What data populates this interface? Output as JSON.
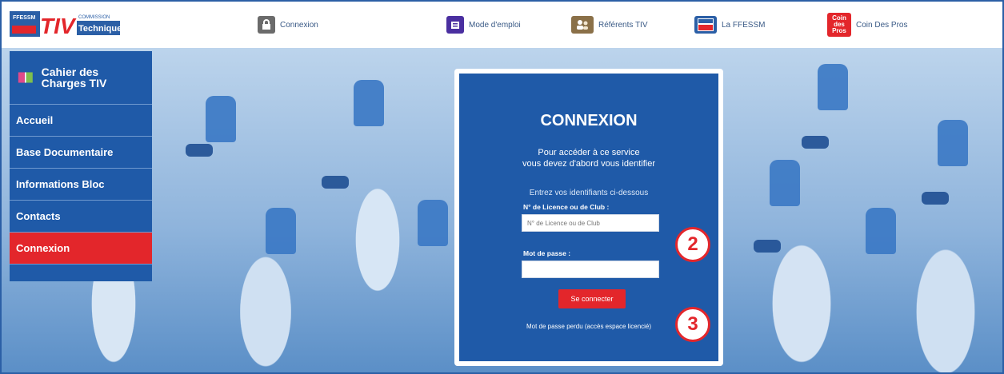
{
  "topnav": {
    "logo_top": "FFESSM",
    "logo_main": "TIV",
    "logo_right1": "COMMISSION",
    "logo_right2": "Technique",
    "items": [
      {
        "label": "Connexion",
        "icon": "lock-icon"
      },
      {
        "label": "Mode d'emploi",
        "icon": "manual-icon"
      },
      {
        "label": "Référents TIV",
        "icon": "people-icon"
      },
      {
        "label": "La FFESSM",
        "icon": "ffessm-icon"
      },
      {
        "label": "Coin Des Pros",
        "icon": "coin-des-pros-icon",
        "badge": "Coin des Pros"
      }
    ]
  },
  "sidebar": {
    "title": "Cahier des Charges TIV",
    "items": [
      {
        "label": "Accueil"
      },
      {
        "label": "Base Documentaire"
      },
      {
        "label": "Informations Bloc"
      },
      {
        "label": "Contacts"
      },
      {
        "label": "Connexion",
        "active": true
      }
    ]
  },
  "login": {
    "title": "CONNEXION",
    "subtitle_line1": "Pour accéder à ce service",
    "subtitle_line2": "vous devez d'abord vous identifier",
    "note": "Entrez vos identifiants ci-dessous",
    "licence_label": "N° de Licence ou de Club :",
    "licence_placeholder": "N° de Licence ou de Club",
    "licence_value": "",
    "password_label": "Mot de passe :",
    "password_value": "",
    "submit": "Se connecter",
    "lost_password": "Mot de passe perdu (accès espace licencié)"
  },
  "callouts": [
    "2",
    "3"
  ],
  "colors": {
    "blue": "#1f5aa8",
    "red": "#e3262b",
    "frame": "#2b5fa6"
  }
}
